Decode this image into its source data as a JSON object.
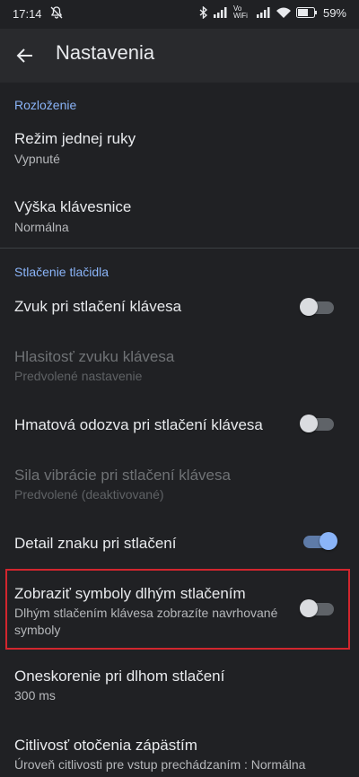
{
  "status": {
    "time": "17:14",
    "battery": "59%",
    "vo_wifi": "Vo WiFi"
  },
  "appbar": {
    "title": "Nastavenia"
  },
  "sections": {
    "layout": "Rozloženie",
    "key_press": "Stlačenie tlačidla"
  },
  "items": {
    "one_hand": {
      "title": "Režim jednej ruky",
      "sub": "Vypnuté"
    },
    "kb_height": {
      "title": "Výška klávesnice",
      "sub": "Normálna"
    },
    "sound": {
      "title": "Zvuk pri stlačení klávesa",
      "toggle": "off"
    },
    "volume": {
      "title": "Hlasitosť zvuku klávesa",
      "sub": "Predvolené nastavenie"
    },
    "haptic": {
      "title": "Hmatová odozva pri stlačení klávesa",
      "toggle": "off"
    },
    "vibration": {
      "title": "Sila vibrácie pri stlačení klávesa",
      "sub": "Predvolené (deaktivované)"
    },
    "popup": {
      "title": "Detail znaku pri stlačení",
      "toggle": "on"
    },
    "longpress_symbols": {
      "title": "Zobraziť symboly dlhým stlačením",
      "sub": "Dlhým stlačením klávesa zobrazíte navrhované symboly",
      "toggle": "off"
    },
    "longpress_delay": {
      "title": "Oneskorenie pri dlhom stlačení",
      "sub": "300 ms"
    },
    "wrist": {
      "title": "Citlivosť otočenia zápästím",
      "sub": "Úroveň citlivosti pre vstup prechádzaním : Normálna"
    }
  },
  "colors": {
    "accent": "#8ab4f8",
    "highlight": "#d2262e",
    "background": "#202124"
  }
}
